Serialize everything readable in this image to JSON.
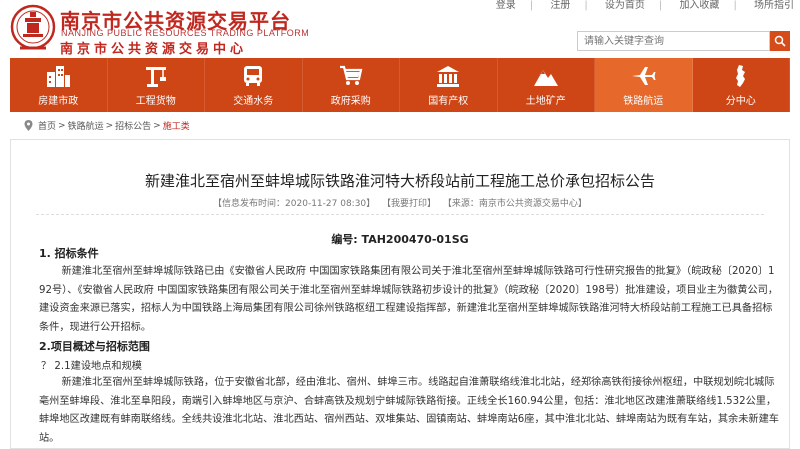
{
  "header": {
    "brand_cn": "南京市公共资源交易平台",
    "brand_en": "NANJING PUBLIC RESOURCES TRADING PLATFORM",
    "brand_cn2": "南京市公共资源交易中心",
    "top_links": [
      "登录",
      "注册",
      "设为首页",
      "加入收藏",
      "场所指引"
    ],
    "search_placeholder": "请输入关键字查询"
  },
  "nav": {
    "items": [
      {
        "label": "房建市政",
        "icon": "buildings-icon"
      },
      {
        "label": "工程货物",
        "icon": "crane-icon"
      },
      {
        "label": "交通水务",
        "icon": "bus-icon"
      },
      {
        "label": "政府采购",
        "icon": "shopping-cart-icon"
      },
      {
        "label": "国有产权",
        "icon": "government-building-icon"
      },
      {
        "label": "土地矿产",
        "icon": "mountain-icon"
      },
      {
        "label": "铁路航运",
        "icon": "airplane-icon"
      },
      {
        "label": "分中心",
        "icon": "map-icon"
      }
    ],
    "active_index": 6
  },
  "breadcrumb": {
    "items": [
      "首页",
      "铁路航运",
      "招标公告",
      "施工类"
    ],
    "separator": ">"
  },
  "article": {
    "title": "新建淮北至宿州至蚌埠城际铁路淮河特大桥段站前工程施工总价承包招标公告",
    "meta": {
      "date": "【信息发布时间：2020-11-27 08:30】",
      "print": "【我要打印】",
      "source": "【来源：南京市公共资源交易中心】"
    },
    "number": "编号: TAH200470-01SG",
    "section1_heading": "1. 招标条件",
    "section1_text": "新建淮北至宿州至蚌埠城际铁路已由《安徽省人民政府 中国国家铁路集团有限公司关于淮北至宿州至蚌埠城际铁路可行性研究报告的批复》（皖政秘〔2020〕192号）、《安徽省人民政府 中国国家铁路集团有限公司关于淮北至宿州至蚌埠城际铁路初步设计的批复》（皖政秘〔2020〕198号）批准建设，项目业主为徽黄公司，建设资金来源已落实，招标人为中国铁路上海局集团有限公司徐州铁路枢纽工程建设指挥部，新建淮北至宿州至蚌埠城际铁路淮河特大桥段站前工程施工已具备招标条件，现进行公开招标。",
    "section2_heading": "2.项目概述与招标范围",
    "section2_sub": "？ 2.1建设地点和规模",
    "section2_text": "新建淮北至宿州至蚌埠城际铁路，位于安徽省北部，经由淮北、宿州、蚌埠三市。线路起自淮萧联络线淮北北站，经郑徐高铁衔接徐州枢纽，中联规划皖北城际亳州至蚌埠段、淮北至阜阳段，南端引入蚌埠地区与京沪、合蚌高铁及规划宁蚌城际铁路衔接。正线全长160.94公里，包括：淮北地区改建淮萧联络线1.532公里，蚌埠地区改建既有蚌南联络线。全线共设淮北北站、淮北西站、宿州西站、双堆集站、固镇南站、蚌埠南站6座，其中淮北北站、蚌埠南站为既有车站，其余未新建车站。"
  },
  "colors": {
    "brand_red": "#c0281f",
    "nav_bg": "#ce4516",
    "nav_active": "#e6682b",
    "search_btn": "#d64b1a"
  }
}
